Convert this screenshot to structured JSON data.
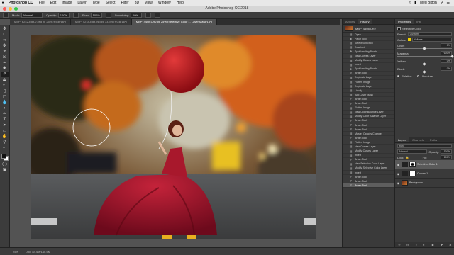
{
  "menubar": {
    "apple": "",
    "items": [
      "Photoshop CC",
      "File",
      "Edit",
      "Image",
      "Layer",
      "Type",
      "Select",
      "Filter",
      "3D",
      "View",
      "Window",
      "Help"
    ],
    "user": "Meg Bitton"
  },
  "titlebar": {
    "title": "Adobe Photoshop CC 2018"
  },
  "options": {
    "mode_label": "Mode:",
    "mode_value": "Normal",
    "opacity_label": "Opacity:",
    "opacity_value": "100%",
    "flow_label": "Flow:",
    "flow_value": "100%",
    "smoothing_label": "Smoothing:",
    "smoothing_value": "10%"
  },
  "tabs": [
    {
      "label": "MBP_6242-Edit-2.psd @ 25% (RGB/16*)",
      "active": false
    },
    {
      "label": "MBP_4218-Edit.psd @ 33.3% (RGB/16*)",
      "active": false
    },
    {
      "label": "MBP_4408.CR2 @ 25% (Selective Color 1, Layer Mask/16*)",
      "active": true
    }
  ],
  "status": {
    "zoom": "25%",
    "doc": "Doc: 84.4M/140.5M"
  },
  "history": {
    "tabs": [
      "Actions",
      "History"
    ],
    "snapshot": "MBP_4408.CR2",
    "items": [
      {
        "icon": "doc",
        "label": "Open"
      },
      {
        "icon": "patch",
        "label": "Patch Tool"
      },
      {
        "icon": "doc",
        "label": "Select Selection"
      },
      {
        "icon": "doc",
        "label": "Deselect"
      },
      {
        "icon": "heal",
        "label": "Spot Healing Brush"
      },
      {
        "icon": "doc",
        "label": "New Curves Layer"
      },
      {
        "icon": "doc",
        "label": "Modify Curves Layer"
      },
      {
        "icon": "doc",
        "label": "Invert"
      },
      {
        "icon": "heal",
        "label": "Spot Healing Brush"
      },
      {
        "icon": "brush",
        "label": "Brush Tool"
      },
      {
        "icon": "doc",
        "label": "Duplicate Layer"
      },
      {
        "icon": "doc",
        "label": "Flatten Image"
      },
      {
        "icon": "doc",
        "label": "Duplicate Layer"
      },
      {
        "icon": "doc",
        "label": "Liquify"
      },
      {
        "icon": "doc",
        "label": "Add Layer Mask"
      },
      {
        "icon": "brush",
        "label": "Brush Tool"
      },
      {
        "icon": "brush",
        "label": "Brush Tool"
      },
      {
        "icon": "doc",
        "label": "Flatten Image"
      },
      {
        "icon": "doc",
        "label": "New Color Balance Layer"
      },
      {
        "icon": "doc",
        "label": "Modify Color Balance Layer"
      },
      {
        "icon": "brush",
        "label": "Brush Tool"
      },
      {
        "icon": "brush",
        "label": "Brush Tool"
      },
      {
        "icon": "brush",
        "label": "Brush Tool"
      },
      {
        "icon": "doc",
        "label": "Master Opacity Change"
      },
      {
        "icon": "brush",
        "label": "Brush Tool"
      },
      {
        "icon": "doc",
        "label": "Flatten Image"
      },
      {
        "icon": "doc",
        "label": "New Curves Layer"
      },
      {
        "icon": "doc",
        "label": "Modify Curves Layer"
      },
      {
        "icon": "doc",
        "label": "Invert"
      },
      {
        "icon": "brush",
        "label": "Brush Tool"
      },
      {
        "icon": "doc",
        "label": "New Selective Color Layer"
      },
      {
        "icon": "doc",
        "label": "Modify Selective Color Layer"
      },
      {
        "icon": "doc",
        "label": "Invert"
      },
      {
        "icon": "brush",
        "label": "Brush Tool"
      },
      {
        "icon": "brush",
        "label": "Brush Tool"
      },
      {
        "icon": "brush",
        "label": "Brush Tool"
      }
    ]
  },
  "properties": {
    "tabs": [
      "Properties",
      "Info"
    ],
    "title": "Selective Color",
    "preset_label": "Preset:",
    "preset_value": "Custom",
    "colors_label": "Colors:",
    "colors_value": "Yellows",
    "sliders": [
      {
        "label": "Cyan:",
        "value": "0%",
        "fraction": 0.5
      },
      {
        "label": "Magenta:",
        "value": "+100%",
        "fraction": 1.0
      },
      {
        "label": "Yellow:",
        "value": "0%",
        "fraction": 0.5
      },
      {
        "label": "Black:",
        "value": "0%",
        "fraction": 0.5
      }
    ],
    "relative": "Relative",
    "absolute": "Absolute",
    "colors_swatch": "#f0d000"
  },
  "layers": {
    "tabs": [
      "Layers",
      "Channels",
      "Paths"
    ],
    "kind": "Kind",
    "blend": "Normal",
    "opacity_label": "Opacity:",
    "opacity_value": "100%",
    "lock_label": "Lock:",
    "fill_label": "Fill:",
    "fill_value": "100%",
    "rows": [
      {
        "name": "Selective Color 1",
        "type": "adjust"
      },
      {
        "name": "Curves 1",
        "type": "adjust"
      },
      {
        "name": "Background",
        "type": "image"
      }
    ],
    "bottom_icons": [
      "link-icon",
      "fx-icon",
      "mask-icon",
      "adjustment-icon",
      "folder-icon",
      "new-layer-icon",
      "trash-icon"
    ]
  }
}
